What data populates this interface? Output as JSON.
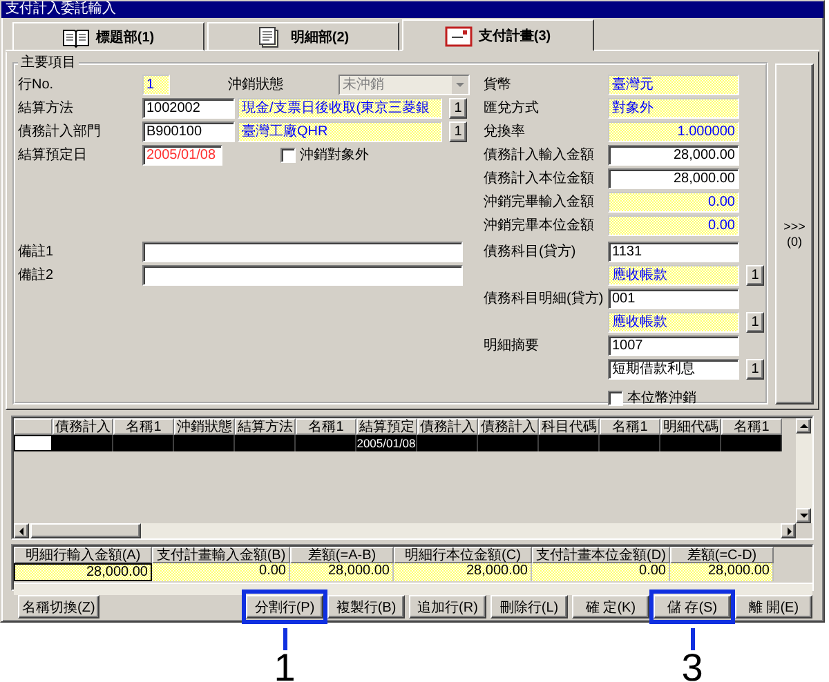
{
  "window": {
    "title": "支付計入委託輸入"
  },
  "tabs": [
    {
      "label": "標題部(1)",
      "selected": false
    },
    {
      "label": "明細部(2)",
      "selected": false
    },
    {
      "label": "支付計畫(3)",
      "selected": true
    }
  ],
  "main": {
    "title": "主要項目",
    "line_no": {
      "label": "行No.",
      "value": "1"
    },
    "status": {
      "label": "沖銷狀態",
      "value": "未沖銷",
      "disabled": true
    },
    "codes": [
      {
        "label": "結算方法",
        "code": "1002002",
        "name": "現金/支票日後收取(東京三菱銀",
        "button": "1"
      },
      {
        "label": "債務計入部門",
        "code": "B900100",
        "name": "臺灣工廠QHR",
        "button": "1"
      }
    ],
    "due_date": {
      "label": "結算預定日",
      "value": "2005/01/08"
    },
    "exclude": {
      "label": "沖銷對象外",
      "checked": false
    },
    "notes": [
      {
        "label": "備註1"
      },
      {
        "label": "備註2"
      }
    ],
    "right": [
      {
        "label": "貨幣",
        "value": "臺灣元",
        "kind": "readonly"
      },
      {
        "label": "匯兌方式",
        "value": "對象外",
        "kind": "readonly"
      },
      {
        "label": "兌換率",
        "value": "1.000000",
        "kind": "readonly",
        "numeric": true
      },
      {
        "label": "債務計入輸入金額",
        "value": "28,000.00",
        "kind": "input",
        "numeric": true
      },
      {
        "label": "債務計入本位金額",
        "value": "28,000.00",
        "kind": "input",
        "numeric": true
      },
      {
        "label": "沖銷完畢輸入金額",
        "value": "0.00",
        "kind": "readonly",
        "numeric": true
      },
      {
        "label": "沖銷完畢本位金額",
        "value": "0.00",
        "kind": "readonly",
        "numeric": true
      },
      {
        "label": "債務科目(貸方)",
        "value": "1131",
        "kind": "input",
        "sub": {
          "value": "應收帳款",
          "kind": "readonly",
          "button": "1"
        }
      },
      {
        "label": "債務科目明細(貸方)",
        "value": "001",
        "kind": "input",
        "sub": {
          "value": "應收帳款",
          "kind": "readonly",
          "button": "1"
        }
      },
      {
        "label": "明細摘要",
        "value": "1007",
        "kind": "input",
        "sub": {
          "value": "短期借款利息",
          "kind": "input",
          "button": "1"
        }
      }
    ],
    "local_offset": {
      "label": "本位幣沖銷",
      "checked": false
    },
    "side_button": {
      "arrows": ">>>",
      "label": "(0)"
    }
  },
  "grid": {
    "columns": [
      "債務計入",
      "名稱1",
      "沖銷狀態",
      "結算方法",
      "名稱1",
      "結算預定",
      "債務計入",
      "債務計入",
      "科目代碼",
      "名稱1",
      "明細代碼",
      "名稱1"
    ],
    "rows": [
      {
        "selected": true,
        "cells": [
          {},
          {},
          {},
          {},
          {},
          {
            "text": "2005/01/08"
          },
          {},
          {},
          {},
          {},
          {},
          {}
        ]
      }
    ]
  },
  "totals": {
    "columns": [
      "明細行輸入金額(A)",
      "支付計畫輸入金額(B)",
      "差額(=A-B)",
      "明細行本位金額(C)",
      "支付計畫本位金額(D)",
      "差額(=C-D)"
    ],
    "values": [
      "28,000.00",
      "0.00",
      "28,000.00",
      "28,000.00",
      "0.00",
      "28,000.00"
    ]
  },
  "buttons": [
    {
      "label": "名稱切換(Z)"
    },
    {
      "label": "分割行(P)",
      "callout": "1"
    },
    {
      "label": "複製行(B)"
    },
    {
      "label": "追加行(R)"
    },
    {
      "label": "刪除行(L)"
    },
    {
      "label": "確 定(K)"
    },
    {
      "label": "儲 存(S)",
      "callout": "3"
    },
    {
      "label": "離 開(E)"
    }
  ]
}
